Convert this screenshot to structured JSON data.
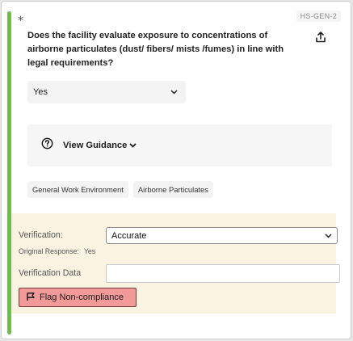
{
  "question": {
    "required_marker": "*",
    "code": "HS-GEN-2",
    "text": "Does the facility evaluate exposure to concentrations of airborne particulates (dust/ fibers/ mists /fumes) in line with legal requirements?",
    "answer": "Yes"
  },
  "guidance": {
    "label": "View Guidance"
  },
  "tags": [
    "General Work Environment",
    "Airborne Particulates"
  ],
  "verification": {
    "label": "Verification:",
    "selected": "Accurate",
    "original_response_label": "Original Response:",
    "original_response_value": "Yes",
    "data_label": "Verification Data",
    "data_value": "",
    "flag_label": "Flag Non-compliance"
  },
  "icons": {
    "export": "upload-icon",
    "help": "question-circle-icon",
    "chevron": "chevron-down-icon",
    "flag": "flag-icon"
  },
  "colors": {
    "accent": "#6fbd4e",
    "verify_panel": "#fbf3e2",
    "flag_button": "#f29a9a"
  }
}
